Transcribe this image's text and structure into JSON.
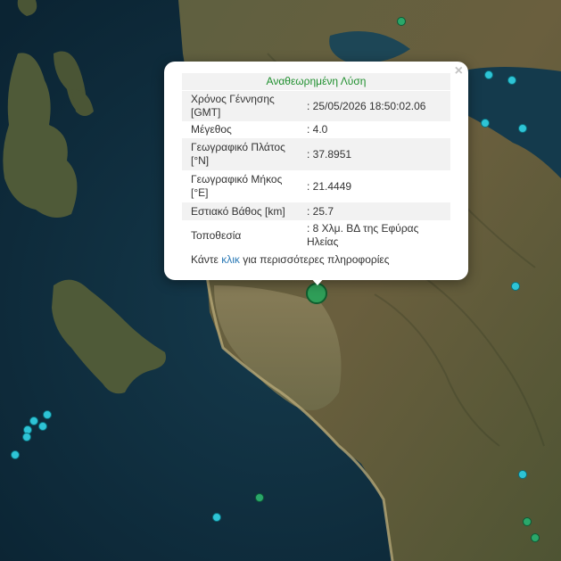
{
  "popup": {
    "title": "Αναθεωρημένη Λύση",
    "rows": [
      {
        "label": "Χρόνος Γέννησης [GMT]",
        "value": ": 25/05/2026 18:50:02.06"
      },
      {
        "label": "Μέγεθος",
        "value": ": 4.0"
      },
      {
        "label": "Γεωγραφικό Πλάτος [°N]",
        "value": ": 37.8951"
      },
      {
        "label": "Γεωγραφικό Μήκος [°E]",
        "value": ": 21.4449"
      },
      {
        "label": "Εστιακό Βάθος [km]",
        "value": ": 25.7"
      },
      {
        "label": "Τοποθεσία",
        "value": ": 8 Χλμ. ΒΔ της Εφύρας Ηλείας"
      }
    ],
    "more_prefix": "Κάντε ",
    "more_link": "κλικ",
    "more_suffix": " για περισσότερες πληροφορίες",
    "close_symbol": "×"
  },
  "colors": {
    "sea": "#0e2c3d",
    "land": "#5a5a3a",
    "marker_cyan": "#2ec4d6",
    "marker_green": "#2aa76a",
    "title_green": "#1f8f2e",
    "link_blue": "#2d7bb6"
  }
}
